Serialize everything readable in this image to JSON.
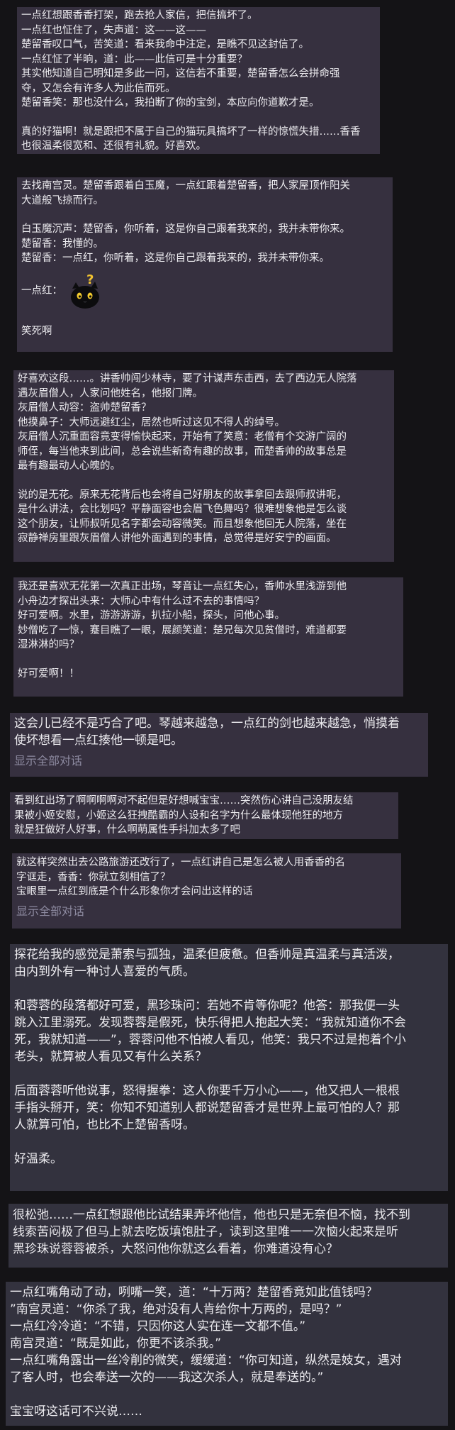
{
  "posts": [
    {
      "paragraphs": [
        [
          "一点红想跟香香打架，跑去抢人家信，把信搞坏了。",
          "一点红也怔住了，失声道：这——这——",
          "楚留香叹口气，苦笑道：看来我命中注定，是瞧不见这封信了。",
          "一点红怔了半晌，道：此——此信可是十分重要？",
          "其实他知道自己明知是多此一问，这信若不重要，楚留香怎么会拼命强",
          "夺，又怎会有许多人为此信而死。",
          "楚留香笑：那也没什么，我拍断了你的宝剑，本应向你道歉才是。"
        ],
        [
          "真的好猫啊！就是跟把不属于自己的猫玩具搞坏了一样的惊慌失措……香香",
          "也很温柔很宽和、还很有礼貌。好喜欢。"
        ]
      ]
    },
    {
      "paragraphs": [
        [
          "去找南宫灵。楚留香跟着白玉魔，一点红跟着楚留香，把人家屋顶作阳关",
          "大道般飞掠而行。"
        ],
        [
          "白玉魔沉声：楚留香，你听着，这是你自己跟着我来的，我并未带你来。",
          "楚留香：我懂的。",
          "楚留香：一点红，你听着，这是你自己跟着我来的，我并未带你来。"
        ]
      ],
      "inline_label": "一点红：",
      "sticker": "black-cat-question-icon",
      "after": "笑死啊"
    },
    {
      "paragraphs": [
        [
          "好喜欢这段……。讲香帅闯少林寺，要了计谋声东击西，去了西边无人院落",
          "遇灰眉僧人，人家问他姓名，他报门牌。",
          "灰眉僧人动容：盗帅楚留香？",
          "他摸鼻子：大师远避红尘，居然也听过这见不得人的绰号。",
          "灰眉僧人沉重面容竟变得愉快起来，开始有了笑意：老僧有个交游广阔的",
          "师侄，每当他来到此间，总会说些新奇有趣的故事，而楚香帅的故事总是",
          "最有趣最动人心魄的。"
        ],
        [
          "说的是无花。原来无花背后也会将自己好朋友的故事拿回去跟师叔讲呢，",
          "是什么讲法，会比划吗？平静面容也会眉飞色舞吗？很难想象他是怎么谈",
          "这个朋友，让师叔听见名字都会动容微笑。而且想象他回无人院落，坐在",
          "寂静禅房里跟灰眉僧人讲他外面遇到的事情，总觉得是好安宁的画面。"
        ]
      ]
    },
    {
      "paragraphs": [
        [
          "我还是喜欢无花第一次真正出场，琴音让一点红失心，香帅水里浅游到他",
          "小舟边才探出头来：大师心中有什么过不去的事情吗？",
          "好可爱啊。水里，游游游游，扒拉小船，探头，问他心事。",
          "妙僧吃了一惊，蹇目瞧了一眼，展颜笑道：楚兄每次见贫僧时，难道都要",
          "湿淋淋的吗？"
        ],
        [
          "好可爱啊！！"
        ]
      ]
    },
    {
      "paragraphs": [
        [
          "这会儿已经不是巧合了吧。琴越来越急，一点红的剑也越来越急，悄摸着",
          "使坏想看一点红揍他一顿是吧。"
        ]
      ],
      "show_all": "显示全部对话"
    },
    {
      "paragraphs": [
        [
          "看到红出场了啊啊啊啊对不起但是好想喊宝宝……突然伤心讲自己没朋友结",
          "果被小姬安慰，小姬这么狂拽酷霸的人设和名字为什么最体现他狂的地方",
          "就是狂做好人好事，什么啊萌属性手抖加太多了吧"
        ]
      ]
    },
    {
      "paragraphs": [
        [
          "就这样突然出去公路旅游还改行了，一点红讲自己是怎么被人用香香的名",
          "字诓走，香香：你就立刻相信了？",
          "宝眼里一点红到底是个什么形象你才会问出这样的话"
        ]
      ],
      "show_all": "显示全部对话"
    },
    {
      "paragraphs": [
        [
          "探花给我的感觉是萧索与孤独，温柔但疲惫。但香帅是真温柔与真活泼，",
          "由内到外有一种讨人喜爱的气质。"
        ],
        [
          "和蓉蓉的段落都好可爱，黑珍珠问：若她不肯等你呢？他答：那我便一头",
          "跳入江里溺死。发现蓉蓉是假死，快乐得把人抱起大笑：“我就知道你不会",
          "死，我就知道——”，蓉蓉问他不怕被人看见，他笑：我只不过是抱着个小",
          "老头，就算被人看见又有什么关系？"
        ],
        [
          "后面蓉蓉听他说事，怒得握拳：这人你要千万小心——，他又把人一根根",
          "手指头掰开，笑：你知不知道别人都说楚留香才是世界上最可怕的人？那",
          "人就算可怕，也比不上楚留香呀。"
        ],
        [
          "好温柔。"
        ]
      ]
    },
    {
      "paragraphs": [
        [
          "很松弛……一点红想跟他比试结果弄坏他信，他也只是无奈但不恼，找不到",
          "线索苦闷极了但马上就去吃饭填饱肚子，读到这里唯一一次恼火起来是听",
          "黑珍珠说蓉蓉被杀，大怒问他你就这么看着，你难道没有心？"
        ]
      ]
    },
    {
      "paragraphs": [
        [
          "一点红嘴角动了动，咧嘴一笑，道：“十万两？楚留香竟如此值钱吗？",
          "”南宫灵道：“你杀了我，绝对没有人肯给你十万两的，是吗？”",
          "一点红冷冷道：“不错，只因你这人实在连一文都不值。”",
          "南宫灵道：“既是如此，你更不该杀我。”",
          "一点红嘴角露出一丝冷削的微笑，缓缓道：“你可知道，纵然是妓女，遇对",
          "了客人时，也会奉送一次的——我这次杀人，就是奉送的。”"
        ],
        [
          "宝宝呀这话可不兴说……"
        ]
      ]
    }
  ],
  "colors": {
    "page_bg": "#141316",
    "card_purple": "#36303f",
    "card_slate": "#33323e",
    "text": "#ecebef",
    "muted": "#8d8aa0"
  }
}
